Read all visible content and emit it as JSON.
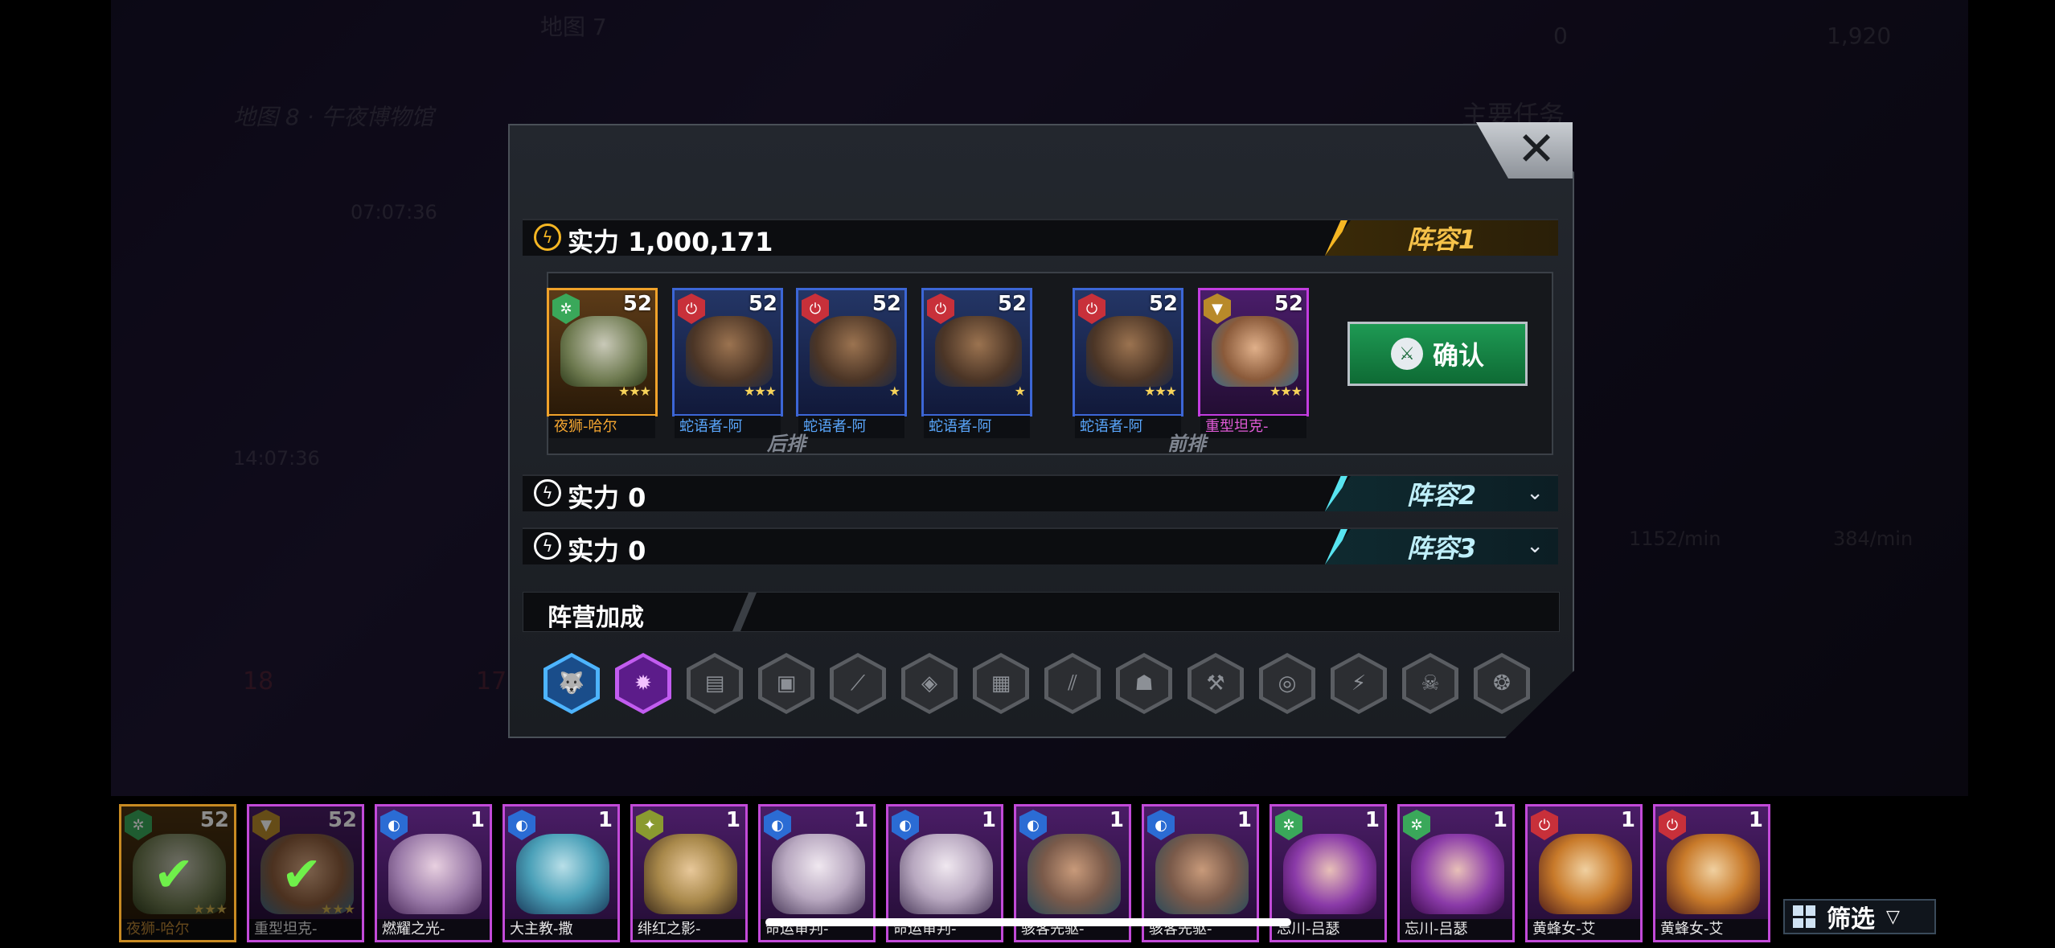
{
  "background": {
    "map_tab_1": "地图 7",
    "map_title": "地图 8 · 午夜博物馆",
    "timer_1": "07:07:36",
    "timer_2": "14:07:36",
    "currency_1": "0",
    "currency_2": "1,920",
    "main_quest": "主要任务",
    "rate_1": "1152/min",
    "rate_2": "384/min",
    "node_1": "18",
    "node_2": "17"
  },
  "teams": [
    {
      "power_label": "实力",
      "power_value": "1,000,171",
      "tag": "阵容1"
    },
    {
      "power_label": "实力",
      "power_value": "0",
      "tag": "阵容2"
    },
    {
      "power_label": "实力",
      "power_value": "0",
      "tag": "阵容3"
    }
  ],
  "lineup": [
    {
      "level": "52",
      "name": "夜狮-哈尔",
      "rarity": "gold",
      "faction": "green",
      "stars": "★★★"
    },
    {
      "level": "52",
      "name": "蛇语者-阿",
      "rarity": "blue",
      "faction": "red",
      "stars": "★★★"
    },
    {
      "level": "52",
      "name": "蛇语者-阿",
      "rarity": "blue",
      "faction": "red",
      "stars": "★"
    },
    {
      "level": "52",
      "name": "蛇语者-阿",
      "rarity": "blue",
      "faction": "red",
      "stars": "★"
    },
    {
      "level": "52",
      "name": "蛇语者-阿",
      "rarity": "blue",
      "faction": "red",
      "stars": "★★★"
    },
    {
      "level": "52",
      "name": "重型坦克-",
      "rarity": "purple",
      "faction": "gold",
      "stars": "★★★"
    }
  ],
  "row_labels": {
    "back": "后排",
    "front": "前排"
  },
  "confirm_label": "确认",
  "faction_bonus_label": "阵营加成",
  "faction_icons": [
    "wolf-icon",
    "flame-icon",
    "crate-icon",
    "tank-icon",
    "blade-icon",
    "drone-icon",
    "turret-icon",
    "claw-icon",
    "robot-icon",
    "hammer-icon",
    "spiral-icon",
    "bolt-icon",
    "skull-icon",
    "beast-icon"
  ],
  "roster": [
    {
      "level": "52",
      "name": "夜狮-哈尔",
      "rarity": "gold",
      "faction": "green",
      "selected": true
    },
    {
      "level": "52",
      "name": "重型坦克-",
      "rarity": "purple",
      "faction": "gold",
      "selected": true
    },
    {
      "level": "1",
      "name": "燃耀之光-",
      "rarity": "purple",
      "faction": "blue",
      "selected": false
    },
    {
      "level": "1",
      "name": "大主教-撒",
      "rarity": "purple",
      "faction": "blue",
      "selected": false
    },
    {
      "level": "1",
      "name": "绯红之影-",
      "rarity": "purple",
      "faction": "olive",
      "selected": false
    },
    {
      "level": "1",
      "name": "命运审判-",
      "rarity": "purple",
      "faction": "blue",
      "selected": false
    },
    {
      "level": "1",
      "name": "命运审判-",
      "rarity": "purple",
      "faction": "blue",
      "selected": false
    },
    {
      "level": "1",
      "name": "骇客先驱-",
      "rarity": "purple",
      "faction": "blue",
      "selected": false
    },
    {
      "level": "1",
      "name": "骇客先驱-",
      "rarity": "purple",
      "faction": "blue",
      "selected": false
    },
    {
      "level": "1",
      "name": "忘川-吕瑟",
      "rarity": "purple",
      "faction": "green",
      "selected": false
    },
    {
      "level": "1",
      "name": "忘川-吕瑟",
      "rarity": "purple",
      "faction": "green",
      "selected": false
    },
    {
      "level": "1",
      "name": "黄蜂女-艾",
      "rarity": "purple",
      "faction": "red",
      "selected": false
    },
    {
      "level": "1",
      "name": "黄蜂女-艾",
      "rarity": "purple",
      "faction": "red",
      "selected": false
    }
  ],
  "filter_label": "筛选",
  "colors": {
    "gold": "#f5b623",
    "cyan": "#58e4f0",
    "confirm_green": "#1e9a54",
    "purple_frame": "#c24ad8",
    "blue_frame": "#3c66d6"
  }
}
